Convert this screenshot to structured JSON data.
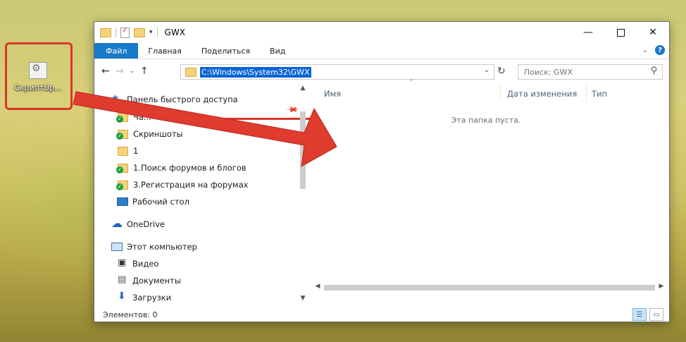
{
  "desktop": {
    "icon_label": "СкриптUp...",
    "accent_color": "#d9362b"
  },
  "window": {
    "title": "GWX",
    "controls": {
      "minimize": "—",
      "maximize": "",
      "close": "✕"
    }
  },
  "ribbon": {
    "tabs": [
      "Файл",
      "Главная",
      "Поделиться",
      "Вид"
    ],
    "file_tab_color": "#1979ca",
    "help": "?"
  },
  "address": {
    "path": "C:\\Windows\\System32\\GWX",
    "search_placeholder": "Поиск: GWX"
  },
  "nav_pane": {
    "quick_access": "Панель быстрого доступа",
    "items": [
      {
        "label": "Ча...",
        "icon": "folder-check-icon"
      },
      {
        "label": "Скриншоты",
        "icon": "folder-check-icon"
      },
      {
        "label": "1",
        "icon": "folder-icon"
      },
      {
        "label": "1.Поиск форумов и блогов",
        "icon": "folder-check-icon"
      },
      {
        "label": "3.Регистрация на форумах",
        "icon": "folder-check-icon"
      },
      {
        "label": "Рабочий стол",
        "icon": "desktop-icon"
      }
    ],
    "onedrive": "OneDrive",
    "this_pc": "Этот компьютер",
    "pc_items": [
      {
        "label": "Видео",
        "icon": "video-icon"
      },
      {
        "label": "Документы",
        "icon": "documents-icon"
      },
      {
        "label": "Загрузки",
        "icon": "downloads-icon"
      }
    ]
  },
  "content": {
    "columns": [
      "Имя",
      "Дата изменения",
      "Тип"
    ],
    "empty_text": "Эта папка пуста."
  },
  "status": {
    "items_count": "Элементов: 0"
  }
}
